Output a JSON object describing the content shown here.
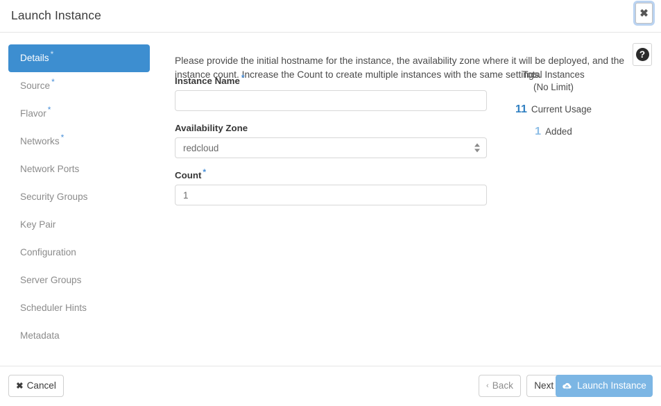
{
  "header": {
    "title": "Launch Instance",
    "close_label": "✖"
  },
  "sidebar": {
    "items": [
      {
        "label": "Details",
        "required": true,
        "active": true
      },
      {
        "label": "Source",
        "required": true,
        "active": false
      },
      {
        "label": "Flavor",
        "required": true,
        "active": false
      },
      {
        "label": "Networks",
        "required": true,
        "active": false
      },
      {
        "label": "Network Ports",
        "required": false,
        "active": false
      },
      {
        "label": "Security Groups",
        "required": false,
        "active": false
      },
      {
        "label": "Key Pair",
        "required": false,
        "active": false
      },
      {
        "label": "Configuration",
        "required": false,
        "active": false
      },
      {
        "label": "Server Groups",
        "required": false,
        "active": false
      },
      {
        "label": "Scheduler Hints",
        "required": false,
        "active": false
      },
      {
        "label": "Metadata",
        "required": false,
        "active": false
      }
    ],
    "required_marker": "*"
  },
  "main": {
    "description": "Please provide the initial hostname for the instance, the availability zone where it will be deployed, and the instance count. Increase the Count to create multiple instances with the same settings.",
    "help_icon": "question-mark-icon",
    "help_glyph": "?",
    "fields": {
      "instance_name": {
        "label": "Instance Name",
        "required": true,
        "value": "",
        "placeholder": ""
      },
      "availability_zone": {
        "label": "Availability Zone",
        "required": false,
        "value": "redcloud",
        "options": [
          "redcloud"
        ]
      },
      "count": {
        "label": "Count",
        "required": true,
        "value": "1",
        "placeholder": ""
      }
    }
  },
  "usage": {
    "title": "Total Instances",
    "subtitle": "(No Limit)",
    "current_usage_value": "11",
    "current_usage_label": "Current Usage",
    "added_value": "1",
    "added_label": "Added"
  },
  "footer": {
    "cancel_label": "Cancel",
    "cancel_icon": "✖",
    "back_label": "Back",
    "back_chevron": "‹",
    "next_label": "Next",
    "next_chevron": "›",
    "launch_label": "Launch Instance",
    "launch_icon": "cloud-upload-icon"
  },
  "colors": {
    "accent_blue": "#3d8ed0",
    "launch_blue": "#7cb6e4",
    "required_blue": "#4a90d9",
    "current_usage_blue": "#2f7fc1",
    "added_blue": "#8cbde6"
  }
}
